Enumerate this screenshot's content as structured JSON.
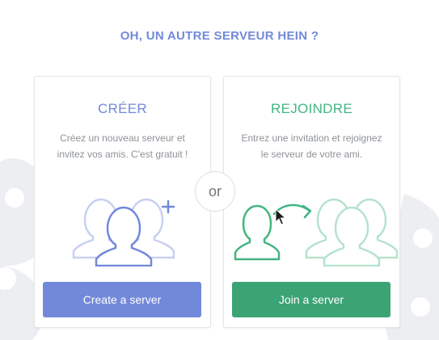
{
  "title": "OH, UN AUTRE SERVEUR HEIN ?",
  "create": {
    "heading": "CRÉER",
    "description": "Créez un nouveau serveur et invitez vos amis. C'est gratuit !",
    "button_label": "Create a server",
    "icon": "group-add-icon"
  },
  "divider": {
    "label": "or"
  },
  "join": {
    "heading": "REJOINDRE",
    "description": "Entrez une invitation et rejoignez le serveur de votre ami.",
    "button_label": "Join a server",
    "icon": "join-group-icon"
  },
  "colors": {
    "create_accent": "#7289da",
    "join_accent": "#43b581",
    "join_button": "#3ca374",
    "text_muted": "#8e9297"
  }
}
